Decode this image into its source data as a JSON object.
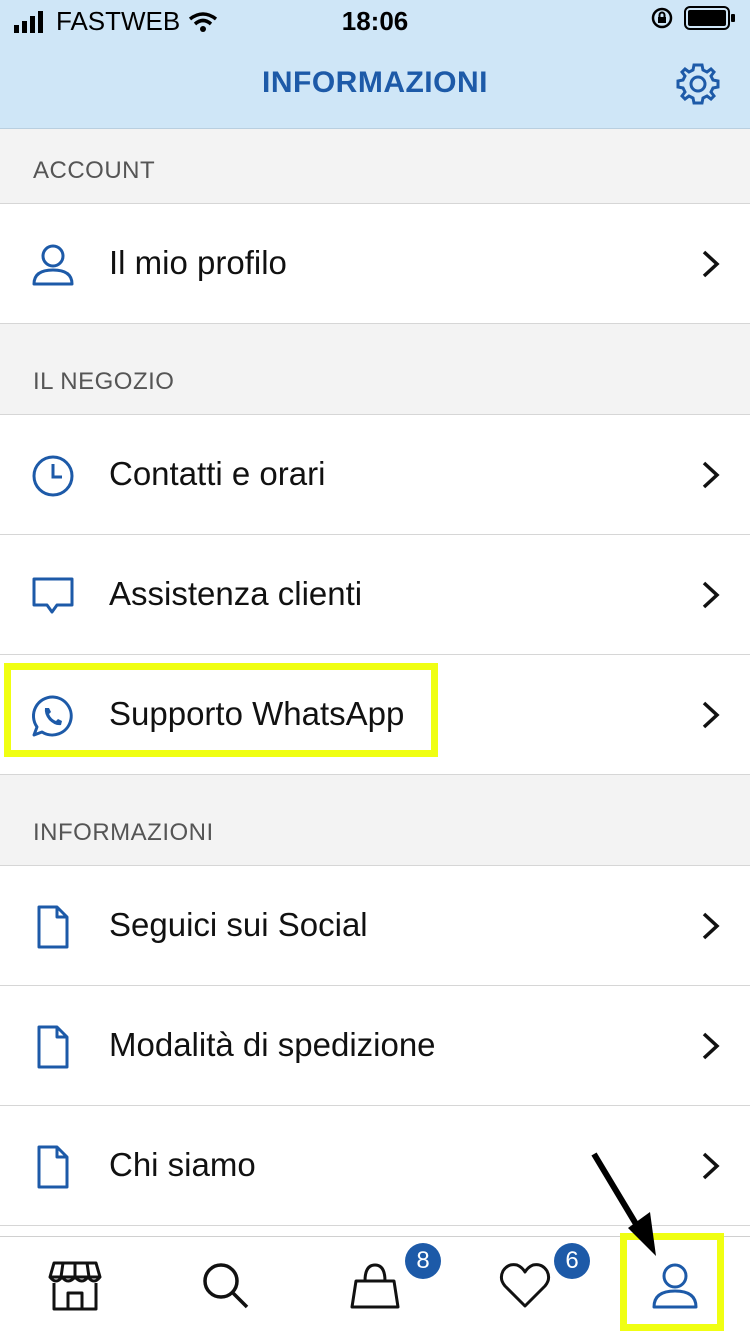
{
  "status": {
    "carrier": "FASTWEB",
    "time": "18:06"
  },
  "header": {
    "title": "INFORMAZIONI"
  },
  "sections": {
    "account": {
      "title": "ACCOUNT",
      "items": [
        {
          "label": "Il mio profilo",
          "icon": "user-icon"
        }
      ]
    },
    "store": {
      "title": "IL NEGOZIO",
      "items": [
        {
          "label": "Contatti e orari",
          "icon": "clock-icon"
        },
        {
          "label": "Assistenza clienti",
          "icon": "chat-bubble-icon"
        },
        {
          "label": "Supporto WhatsApp",
          "icon": "whatsapp-icon"
        }
      ]
    },
    "info": {
      "title": "INFORMAZIONI",
      "items": [
        {
          "label": "Seguici sui Social",
          "icon": "document-icon"
        },
        {
          "label": "Modalità di spedizione",
          "icon": "document-icon"
        },
        {
          "label": "Chi siamo",
          "icon": "document-icon"
        }
      ]
    }
  },
  "tabbar": {
    "tabs": [
      {
        "name": "store",
        "icon": "storefront-icon"
      },
      {
        "name": "search",
        "icon": "search-icon"
      },
      {
        "name": "cart",
        "icon": "shopping-bag-icon",
        "badge": "8"
      },
      {
        "name": "wishlist",
        "icon": "heart-icon",
        "badge": "6"
      },
      {
        "name": "account",
        "icon": "user-icon"
      }
    ]
  },
  "colors": {
    "accent": "#1d5aa8",
    "header_bg": "#cfe6f7",
    "highlight": "#f0ff12"
  }
}
